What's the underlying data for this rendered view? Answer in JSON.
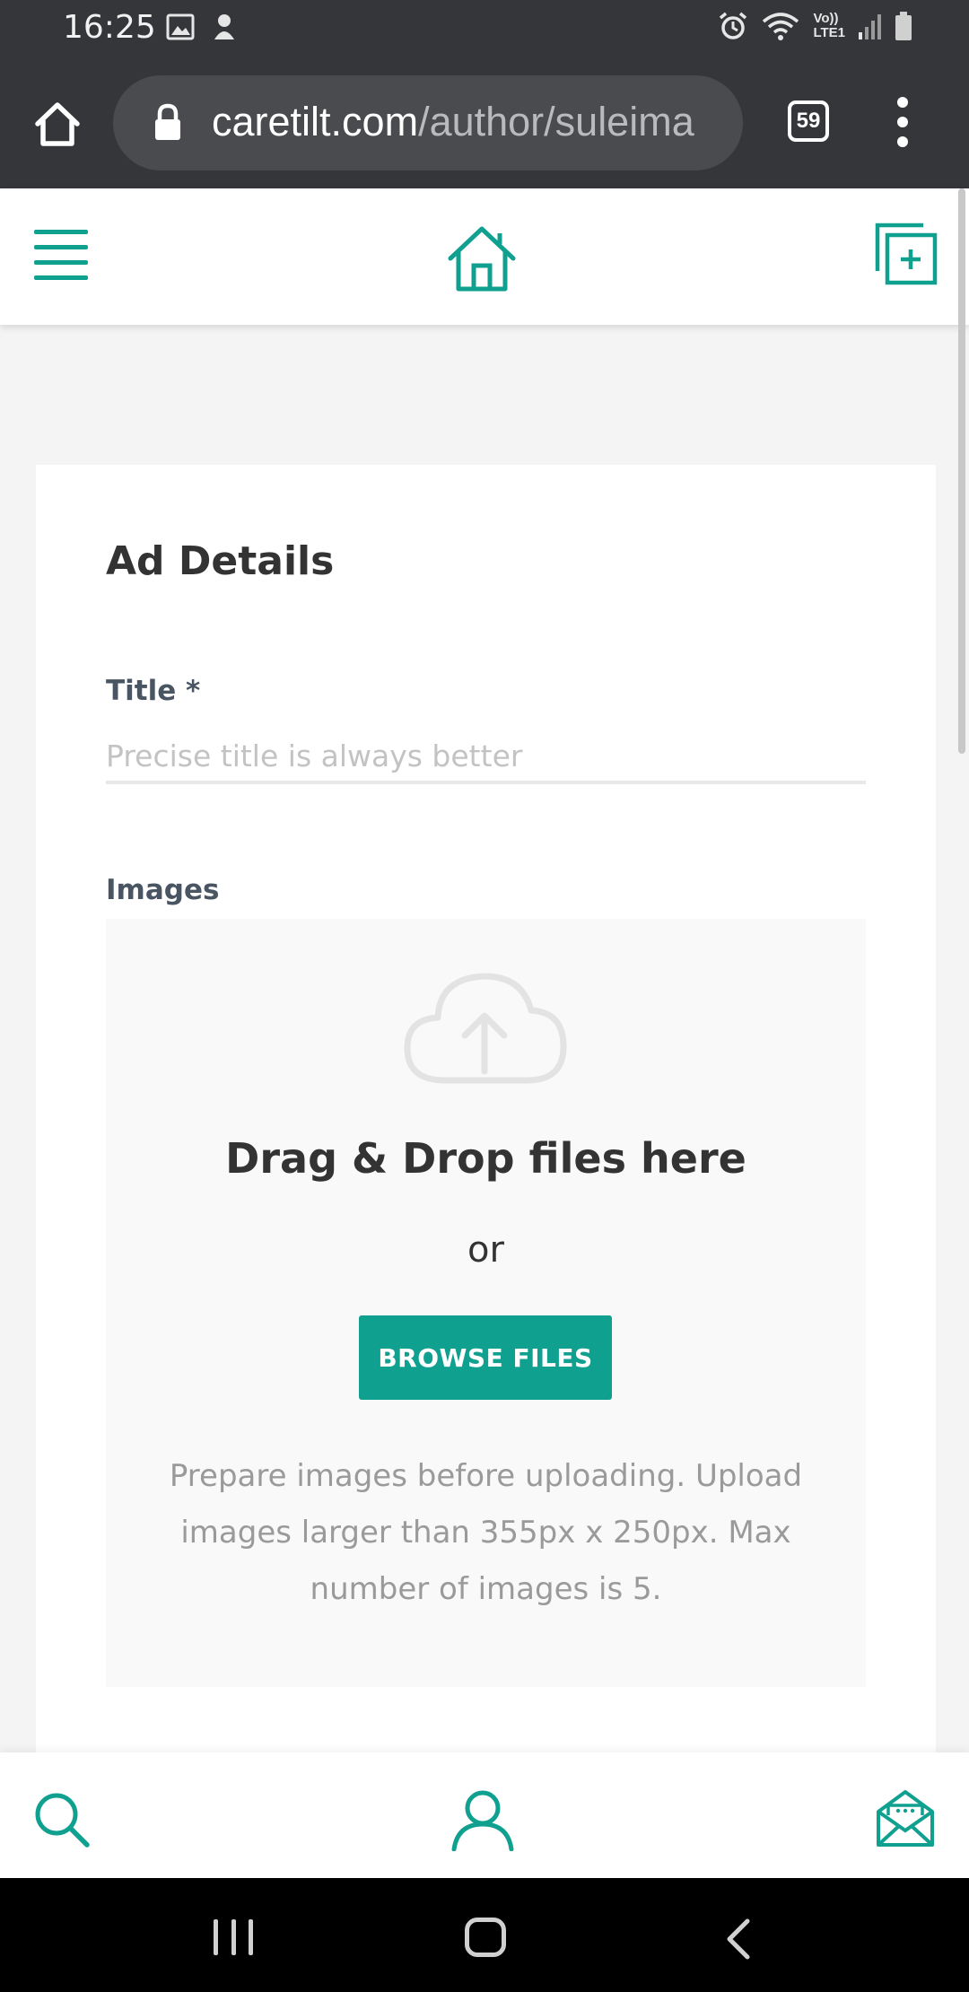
{
  "status_bar": {
    "time": "16:25",
    "left_icons": [
      "image-icon",
      "mascot-icon"
    ],
    "right_icons": [
      "alarm-icon",
      "wifi-icon",
      "volte-icon",
      "signal-icon",
      "battery-icon"
    ],
    "volte_text_top": "Vo))",
    "volte_text_bottom": "LTE1"
  },
  "browser": {
    "url_host": "caretilt.com",
    "url_path": "/author/suleima",
    "tab_count": "59"
  },
  "header": {
    "menu_icon": "hamburger-icon",
    "home_icon": "house-icon",
    "new_post_icon": "add-post-icon"
  },
  "form": {
    "section_title": "Ad Details",
    "title_label": "Title *",
    "title_placeholder": "Precise title is always better",
    "title_value": "",
    "images_label": "Images",
    "dropzone": {
      "icon": "cloud-upload-icon",
      "heading": "Drag & Drop files here",
      "or_text": "or",
      "browse_label": "BROWSE FILES",
      "help_text": "Prepare images before uploading. Upload images larger than 355px x 250px. Max number of images is 5."
    }
  },
  "bottom_nav": {
    "items": [
      "search-icon",
      "user-icon",
      "mail-icon"
    ]
  },
  "colors": {
    "accent": "#10a08f",
    "browser_chrome": "#35363a",
    "url_pill": "#4a4b4f"
  }
}
